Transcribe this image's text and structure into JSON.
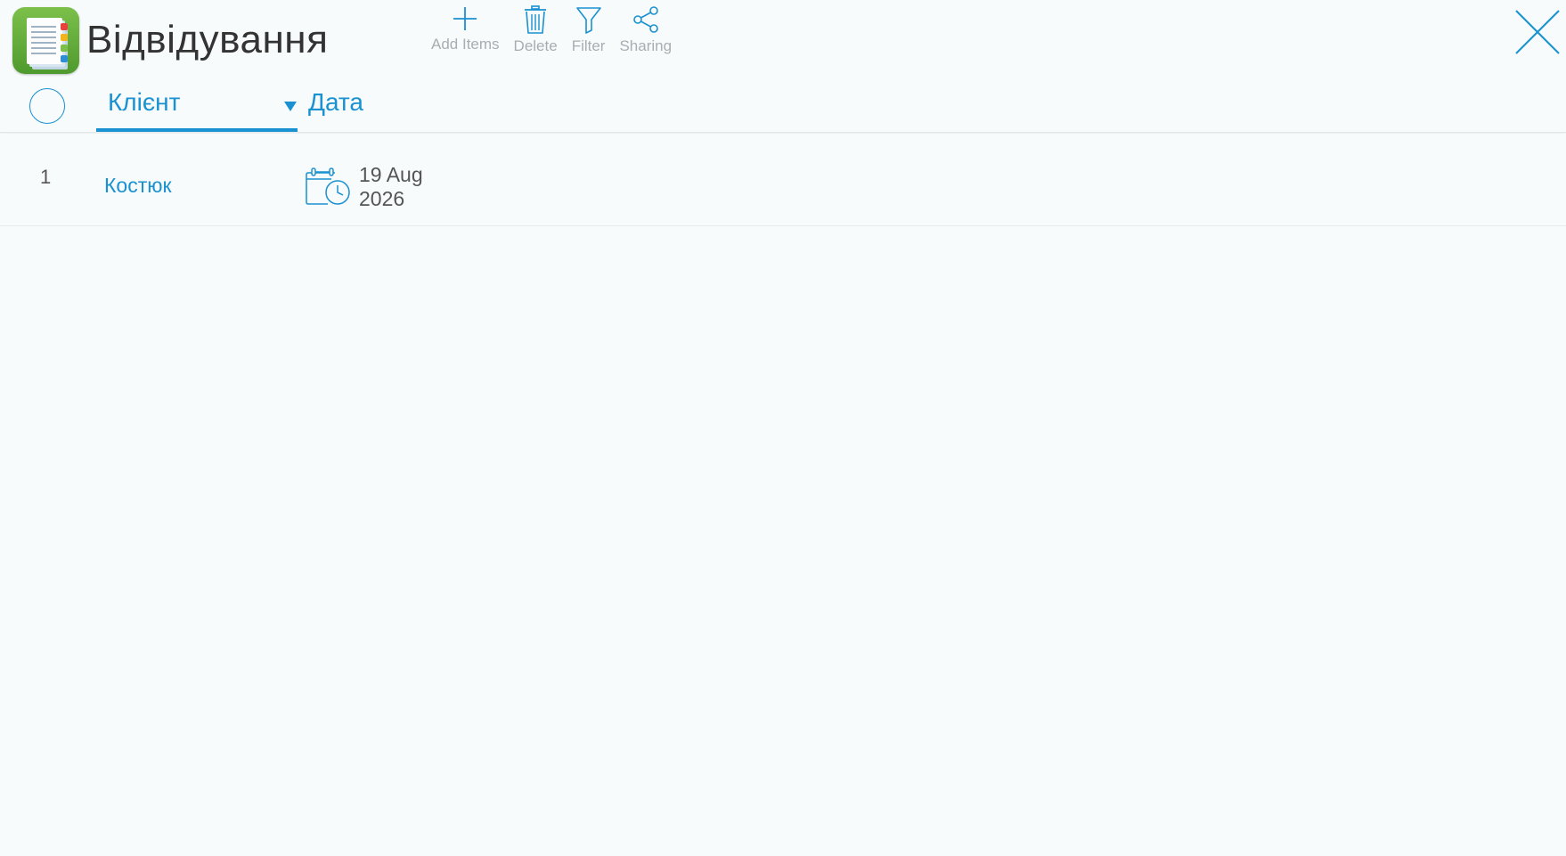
{
  "header": {
    "title": "Відвідування",
    "app_icon": "notebook-app-icon",
    "accent_color": "#1a91d0"
  },
  "toolbar": {
    "add_label": "Add Items",
    "delete_label": "Delete",
    "filter_label": "Filter",
    "sharing_label": "Sharing"
  },
  "columns": {
    "client": "Клієнт",
    "date": "Дата",
    "sort_column": "client",
    "sort_direction": "descending"
  },
  "rows": [
    {
      "number": "1",
      "client": "Костюк",
      "date_line1": "19 Aug",
      "date_line2": "2026",
      "icon": "calendar-clock-icon"
    }
  ]
}
